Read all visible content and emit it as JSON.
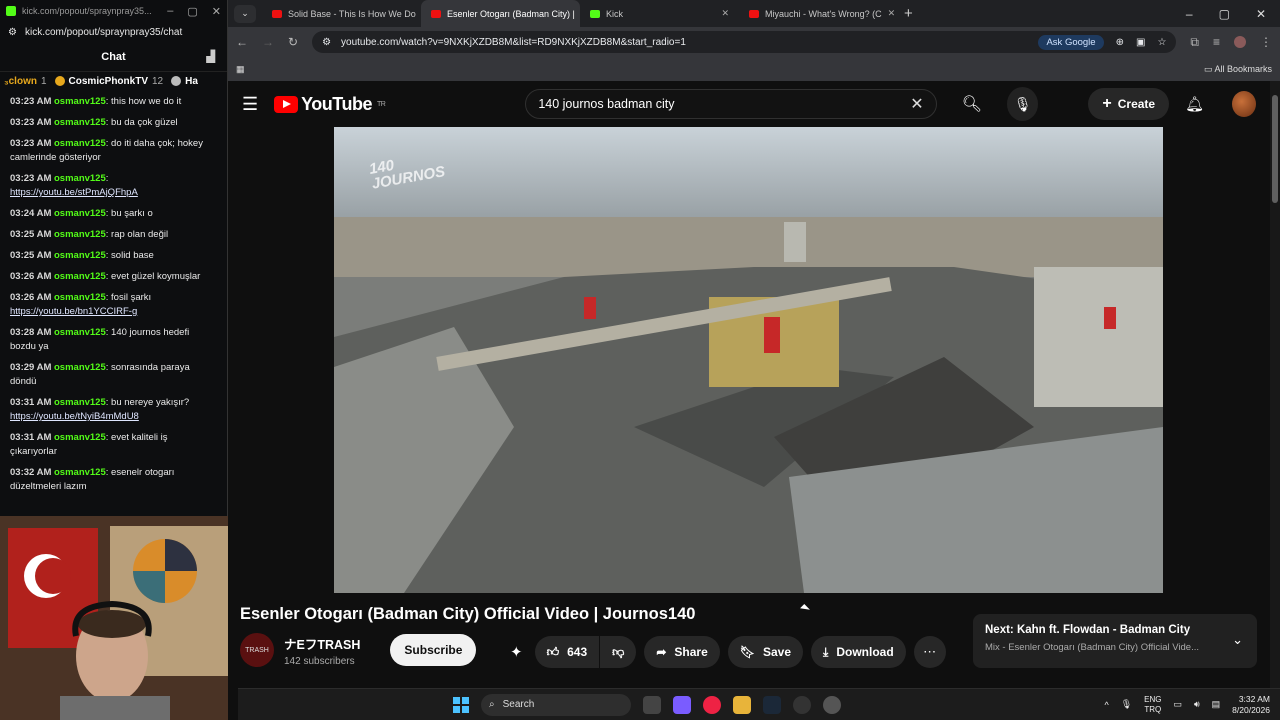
{
  "chat_window": {
    "title": "kick.com/popout/spraynpray35...",
    "url": "kick.com/popout/spraynpray35/chat",
    "header": "Chat",
    "gifters": [
      {
        "name": "₃clown",
        "count": "1"
      },
      {
        "name": "CosmicPhonkTV",
        "count": "12"
      },
      {
        "name": "Ha",
        "count": ""
      }
    ],
    "messages": [
      {
        "time": "03:23 AM",
        "user": "osmanv125",
        "text": "this how we do it",
        "link": ""
      },
      {
        "time": "03:23 AM",
        "user": "osmanv125",
        "text": "bu da çok güzel",
        "link": ""
      },
      {
        "time": "03:23 AM",
        "user": "osmanv125",
        "text": "do iti daha çok; hokey camlerinde gösteriyor",
        "link": ""
      },
      {
        "time": "03:23 AM",
        "user": "osmanv125",
        "text": "",
        "link": "https://youtu.be/stPmAjQFhpA"
      },
      {
        "time": "03:24 AM",
        "user": "osmanv125",
        "text": "bu şarkı o",
        "link": ""
      },
      {
        "time": "03:25 AM",
        "user": "osmanv125",
        "text": "rap olan değil",
        "link": ""
      },
      {
        "time": "03:25 AM",
        "user": "osmanv125",
        "text": "solid base",
        "link": ""
      },
      {
        "time": "03:26 AM",
        "user": "osmanv125",
        "text": "evet güzel koymuşlar",
        "link": ""
      },
      {
        "time": "03:26 AM",
        "user": "osmanv125",
        "text": "fosil şarkı",
        "link": "https://youtu.be/bn1YCCIRF-g"
      },
      {
        "time": "03:28 AM",
        "user": "osmanv125",
        "text": "140 journos hedefi bozdu ya",
        "link": ""
      },
      {
        "time": "03:29 AM",
        "user": "osmanv125",
        "text": "sonrasında paraya döndü",
        "link": ""
      },
      {
        "time": "03:31 AM",
        "user": "osmanv125",
        "text": "bu nereye yakışır?",
        "link": "https://youtu.be/tNyiB4mMdU8"
      },
      {
        "time": "03:31 AM",
        "user": "osmanv125",
        "text": "evet kaliteli iş çıkarıyorlar",
        "link": ""
      },
      {
        "time": "03:32 AM",
        "user": "osmanv125",
        "text": "esenelr otogarı düzeltmeleri lazım",
        "link": ""
      }
    ]
  },
  "browser": {
    "tabs": [
      {
        "label": "Solid Base - This Is How We Do",
        "active": false,
        "kind": "yt"
      },
      {
        "label": "Esenler Otogarı (Badman City) |",
        "active": true,
        "kind": "yt"
      },
      {
        "label": "Kick",
        "active": false,
        "kind": "kick"
      },
      {
        "label": "Miyauchi - What's Wrong? (C",
        "active": false,
        "kind": "yt"
      }
    ],
    "url": "youtube.com/watch?v=9NXKjXZDB8M&list=RD9NXKjXZDB8M&start_radio=1",
    "ask_google": "Ask Google",
    "all_bookmarks": "All Bookmarks"
  },
  "youtube": {
    "logo_text": "YouTube",
    "region": "TR",
    "search_query": "140 journos badman city",
    "create_label": "Create",
    "video_title": "Esenler Otogarı (Badman City) Official Video | Journos140",
    "watermark": "140 JOURNOS",
    "channel_name": "ナEフTRASH",
    "subscribers": "142 subscribers",
    "subscribe_label": "Subscribe",
    "likes": "643",
    "share_label": "Share",
    "save_label": "Save",
    "download_label": "Download",
    "next_title": "Next: Kahn ft. Flowdan - Badman City",
    "next_subtitle": "Mix - Esenler Otogarı (Badman City) Official Vide..."
  },
  "taskbar": {
    "search_label": "Search",
    "lang_top": "ENG",
    "lang_bottom": "TRQ",
    "time": "3:32 AM",
    "date": "8/20/2026"
  }
}
